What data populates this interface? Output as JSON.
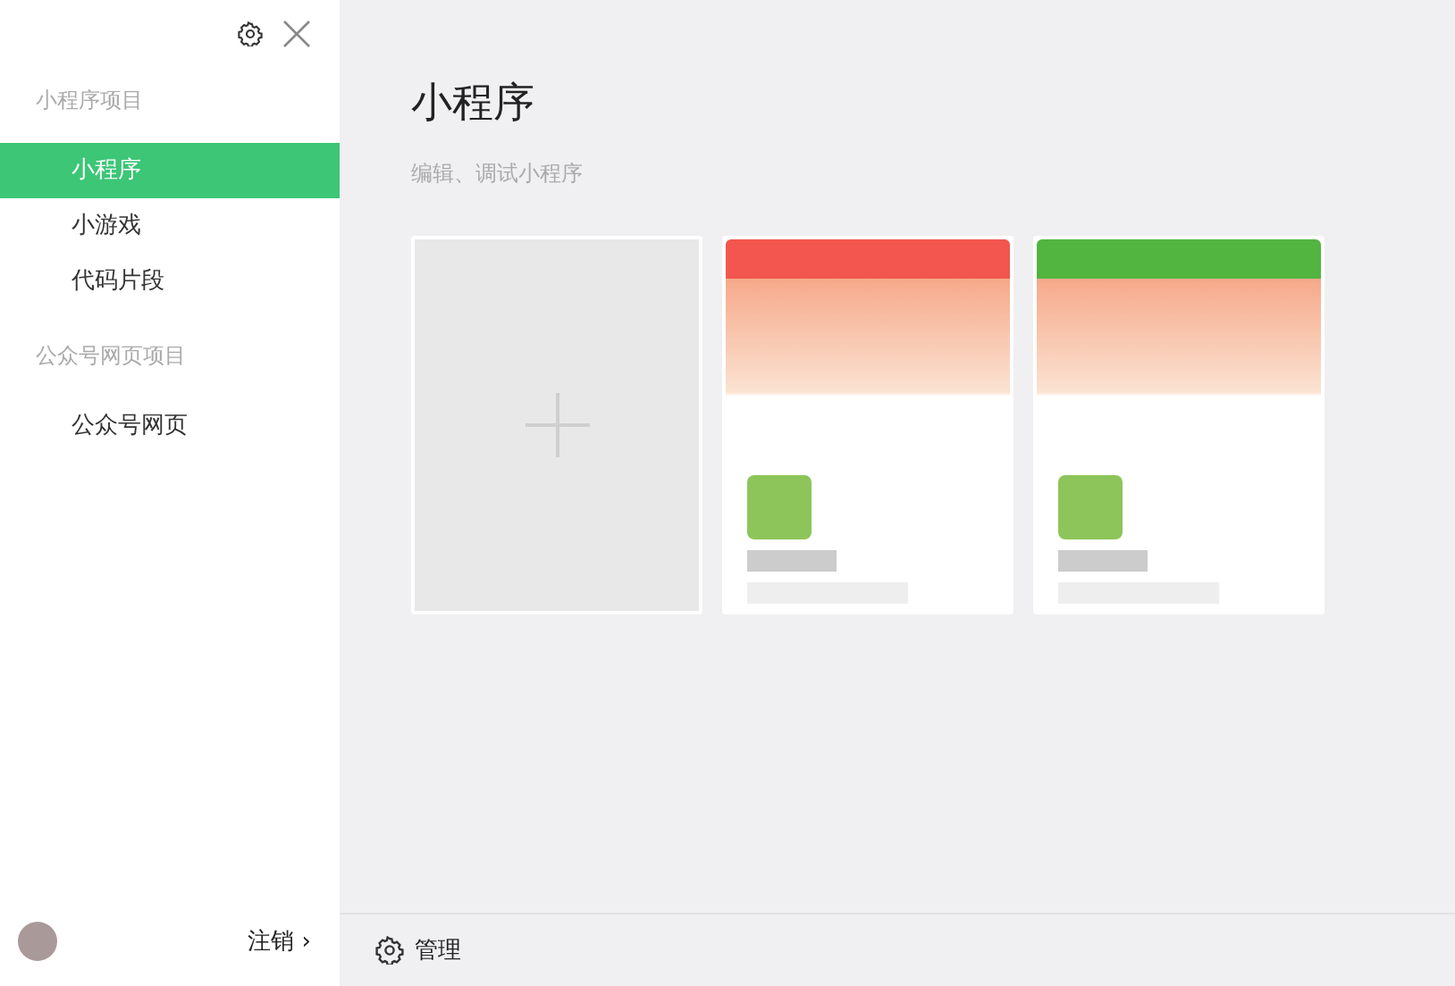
{
  "sidebar": {
    "sections": [
      {
        "title": "小程序项目",
        "items": [
          {
            "label": "小程序",
            "selected": true
          },
          {
            "label": "小游戏",
            "selected": false
          },
          {
            "label": "代码片段",
            "selected": false
          }
        ]
      },
      {
        "title": "公众号网页项目",
        "items": [
          {
            "label": "公众号网页",
            "selected": false
          }
        ]
      }
    ],
    "logout": {
      "label": "注销",
      "arrow": "›"
    }
  },
  "main": {
    "title": "小程序",
    "subtitle": "编辑、调试小程序",
    "projects": [
      {
        "kind": "new"
      },
      {
        "kind": "project",
        "color": "#f2564e"
      },
      {
        "kind": "project",
        "color": "#52b540"
      }
    ],
    "footer": {
      "label": "管理"
    }
  }
}
